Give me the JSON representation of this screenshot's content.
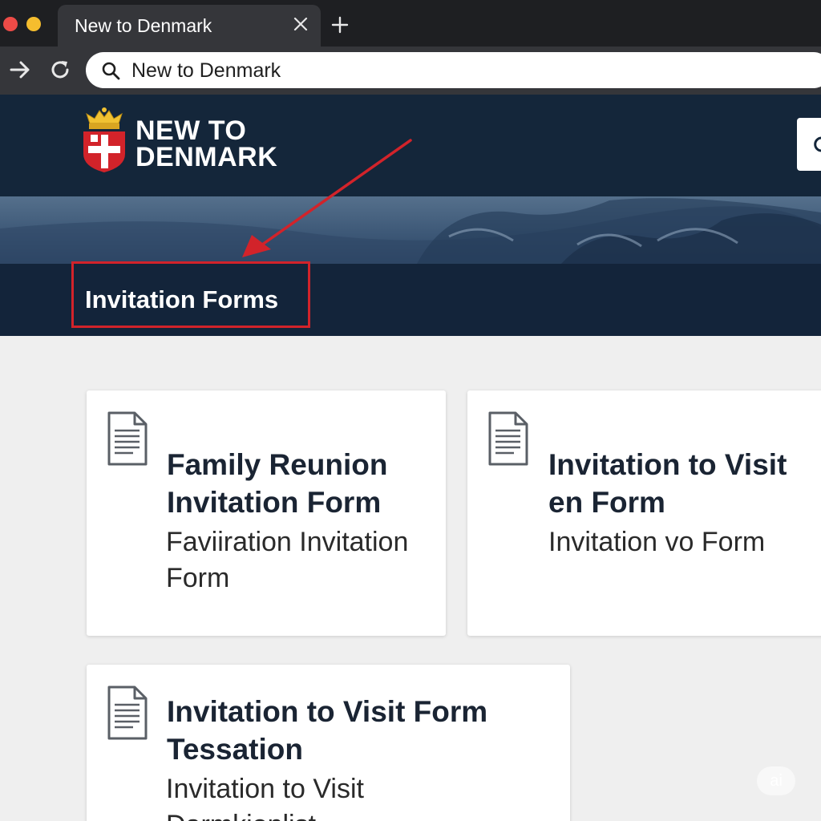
{
  "browser": {
    "tab_title": "New to Denmark",
    "address_text": "New to Denmark",
    "icons": [
      "close-icon",
      "plus-icon",
      "arrow-right-icon",
      "reload-icon",
      "search-icon"
    ]
  },
  "site": {
    "brand_line1": "NEW TO",
    "brand_line2": "DENMARK",
    "page_title": "Invitation Forms"
  },
  "annotation": {
    "color": "#d2232a"
  },
  "cards": [
    {
      "title": "Family Reunion Invitation Form",
      "subtitle": "Faviiration Invitation Form"
    },
    {
      "title": "Invitation to Visit en Form",
      "subtitle": "Invitation vo Form"
    },
    {
      "title": "Invitation to Visit Form Tessation",
      "subtitle": "Invitation to Visit Darmkionlist"
    }
  ],
  "watermark": "ai",
  "colors": {
    "header": "#14263a",
    "title_bar": "#13243a",
    "card_title": "#1a2433",
    "page_bg": "#efefef"
  }
}
